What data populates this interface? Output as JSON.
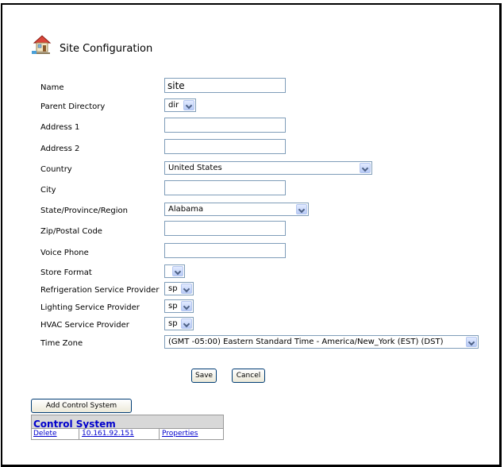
{
  "title": "Site Configuration",
  "fields": {
    "name_label": "Name",
    "name_value": "site",
    "parent_directory_label": "Parent Directory",
    "parent_directory_value": "dir",
    "address1_label": "Address 1",
    "address1_value": "",
    "address2_label": "Address 2",
    "address2_value": "",
    "country_label": "Country",
    "country_value": "United States",
    "city_label": "City",
    "city_value": "",
    "state_label": "State/Province/Region",
    "state_value": "Alabama",
    "zip_label": "Zip/Postal Code",
    "zip_value": "",
    "phone_label": "Voice Phone",
    "phone_value": "",
    "store_format_label": "Store Format",
    "store_format_value": "",
    "refrigeration_label": "Refrigeration Service Provider",
    "refrigeration_value": "sp",
    "lighting_label": "Lighting Service Provider",
    "lighting_value": "sp",
    "hvac_label": "HVAC Service Provider",
    "hvac_value": "sp",
    "timezone_label": "Time Zone",
    "timezone_value": "(GMT -05:00) Eastern Standard Time - America/New_York (EST) (DST)"
  },
  "buttons": {
    "save": "Save",
    "cancel": "Cancel",
    "add_control_system": "Add Control System"
  },
  "control_system": {
    "heading": "Control System",
    "rows": [
      {
        "delete": "Delete",
        "address": "10.161.92.151",
        "properties": "Properties"
      }
    ]
  }
}
